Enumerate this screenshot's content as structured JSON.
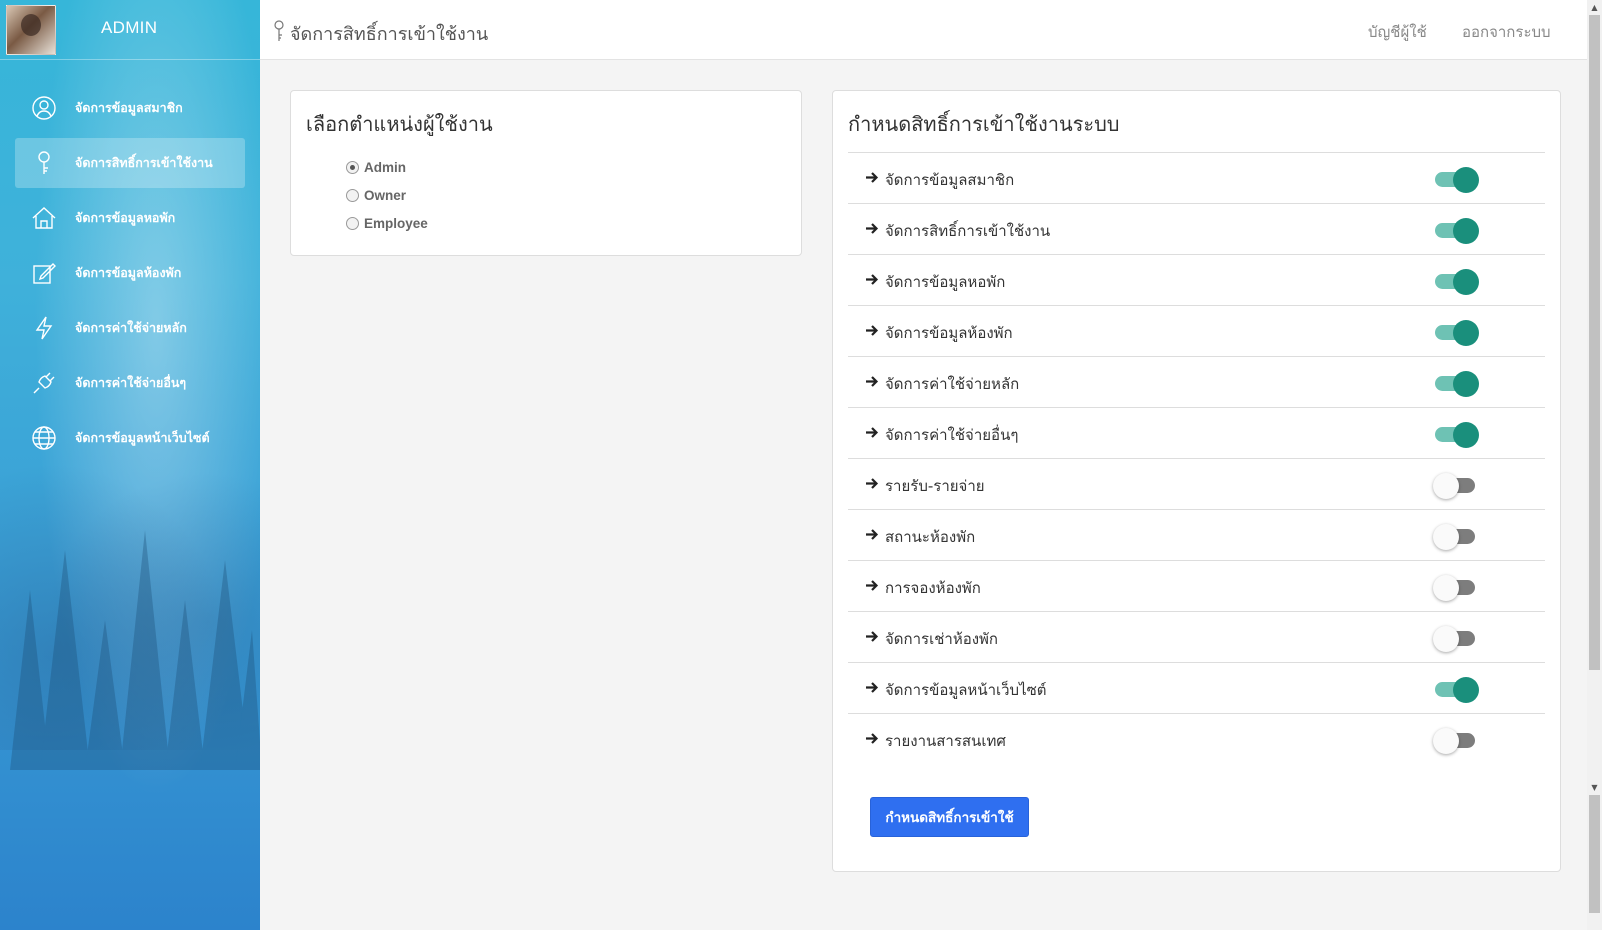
{
  "sidebar": {
    "brand_title": "ADMIN",
    "items": [
      {
        "label": "จัดการข้อมูลสมาชิก",
        "icon": "user-circle-icon",
        "active": false
      },
      {
        "label": "จัดการสิทธิ์การเข้าใช้งาน",
        "icon": "key-icon",
        "active": true
      },
      {
        "label": "จัดการข้อมูลหอพัก",
        "icon": "home-icon",
        "active": false
      },
      {
        "label": "จัดการข้อมูลห้องพัก",
        "icon": "edit-icon",
        "active": false
      },
      {
        "label": "จัดการค่าใช้จ่ายหลัก",
        "icon": "lightning-icon",
        "active": false
      },
      {
        "label": "จัดการค่าใช้จ่ายอื่นๆ",
        "icon": "plug-icon",
        "active": false
      },
      {
        "label": "จัดการข้อมูลหน้าเว็บไซต์",
        "icon": "globe-icon",
        "active": false
      }
    ]
  },
  "topbar": {
    "title": "จัดการสิทธิ์การเข้าใช้งาน",
    "account_label": "บัญชีผู้ใช้",
    "logout_label": "ออกจากระบบ"
  },
  "role_card": {
    "title": "เลือกตำแหน่งผู้ใช้งาน",
    "options": [
      {
        "label": "Admin",
        "checked": true
      },
      {
        "label": "Owner",
        "checked": false
      },
      {
        "label": "Employee",
        "checked": false
      }
    ]
  },
  "permission_card": {
    "title": "กำหนดสิทธิ์การเข้าใช้งานระบบ",
    "items": [
      {
        "label": "จัดการข้อมูลสมาชิก",
        "enabled": true
      },
      {
        "label": "จัดการสิทธิ์การเข้าใช้งาน",
        "enabled": true
      },
      {
        "label": "จัดการข้อมูลหอพัก",
        "enabled": true
      },
      {
        "label": "จัดการข้อมูลห้องพัก",
        "enabled": true
      },
      {
        "label": "จัดการค่าใช้จ่ายหลัก",
        "enabled": true
      },
      {
        "label": "จัดการค่าใช้จ่ายอื่นๆ",
        "enabled": true
      },
      {
        "label": "รายรับ-รายจ่าย",
        "enabled": false
      },
      {
        "label": "สถานะห้องพัก",
        "enabled": false
      },
      {
        "label": "การจองห้องพัก",
        "enabled": false
      },
      {
        "label": "จัดการเช่าห้องพัก",
        "enabled": false
      },
      {
        "label": "จัดการข้อมูลหน้าเว็บไซต์",
        "enabled": true
      },
      {
        "label": "รายงานสารสนเทศ",
        "enabled": false
      }
    ],
    "submit_label": "กำหนดสิทธิ์การเข้าใช้"
  },
  "colors": {
    "sidebar_top": "#36b6d9",
    "sidebar_bottom": "#2c83cc",
    "toggle_on": "#1a8f7c",
    "toggle_off": "#7d7d7d",
    "primary_button": "#2f6ff0"
  }
}
